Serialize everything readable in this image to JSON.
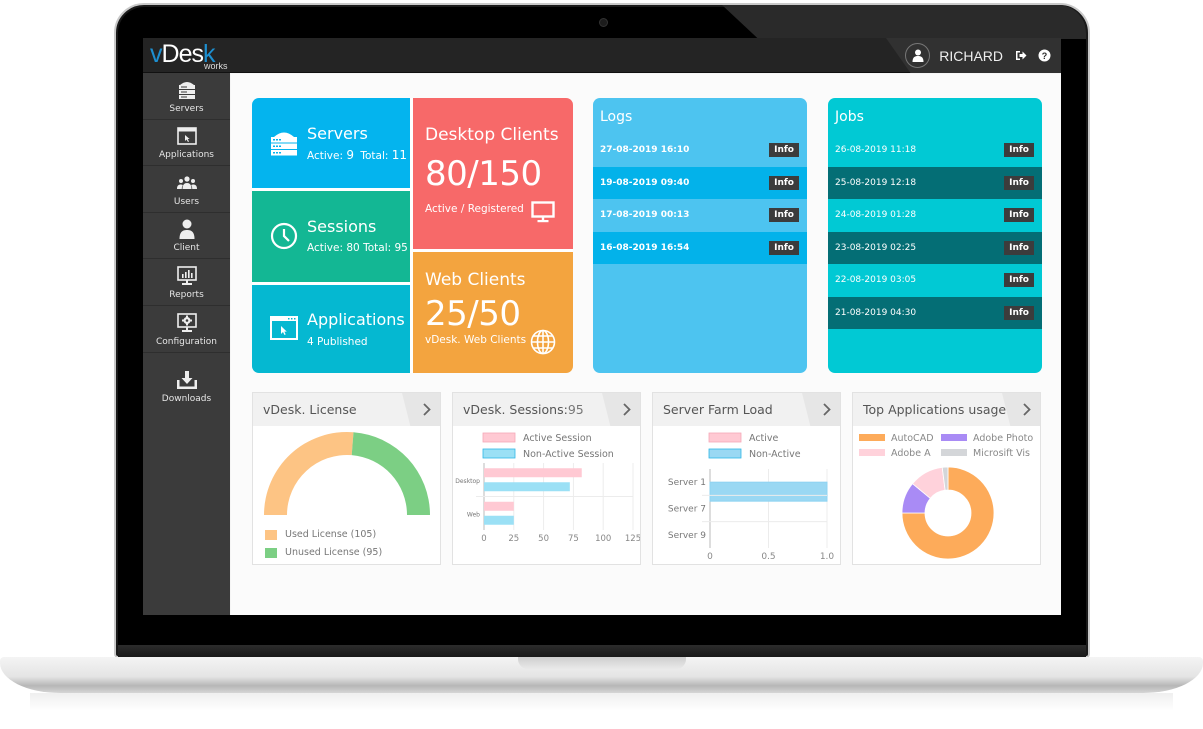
{
  "app": {
    "logo_main": "vDesk",
    "logo_sub": "works"
  },
  "header": {
    "username": "RICHARD",
    "icons": [
      "user-avatar-icon",
      "logout-icon",
      "help-icon"
    ]
  },
  "sidebar": {
    "items": [
      {
        "label": "Servers",
        "icon": "server-icon"
      },
      {
        "label": "Applications",
        "icon": "application-window-icon"
      },
      {
        "label": "Users",
        "icon": "users-group-icon"
      },
      {
        "label": "Client",
        "icon": "client-user-icon"
      },
      {
        "label": "Reports",
        "icon": "reports-monitor-icon"
      },
      {
        "label": "Configuration",
        "icon": "configuration-monitor-icon"
      },
      {
        "label": "Downloads",
        "icon": "download-icon"
      }
    ]
  },
  "tiles": {
    "servers": {
      "title": "Servers",
      "active_label": "Active:",
      "active": "9",
      "total_label": "Total:",
      "total": "11",
      "color": "#04b4ee"
    },
    "sessions": {
      "title": "Sessions",
      "active_label": "Active:",
      "active": "80",
      "total_label": "Total:",
      "total": "95",
      "color": "#13b794"
    },
    "applications": {
      "title": "Applications",
      "subtitle": "4 Published",
      "color": "#05b8d1"
    },
    "desktop_clients": {
      "title": "Desktop Clients",
      "value": "80/150",
      "subtitle": "Active / Registered",
      "color": "#f76969"
    },
    "web_clients": {
      "title": "Web Clients",
      "value": "25/50",
      "subtitle": "vDesk. Web Clients",
      "color": "#f3a43f"
    }
  },
  "logs": {
    "title": "Logs",
    "rows": [
      {
        "time": "27-08-2019 16:10",
        "button": "Info"
      },
      {
        "time": "19-08-2019 09:40",
        "button": "Info"
      },
      {
        "time": "17-08-2019 00:13",
        "button": "Info"
      },
      {
        "time": "16-08-2019 16:54",
        "button": "Info"
      }
    ]
  },
  "jobs": {
    "title": "Jobs",
    "rows": [
      {
        "time": "26-08-2019 11:18",
        "button": "Info"
      },
      {
        "time": "25-08-2019 12:18",
        "button": "Info"
      },
      {
        "time": "24-08-2019 01:28",
        "button": "Info"
      },
      {
        "time": "23-08-2019 02:25",
        "button": "Info"
      },
      {
        "time": "22-08-2019 03:05",
        "button": "Info"
      },
      {
        "time": "21-08-2019 04:30",
        "button": "Info"
      }
    ]
  },
  "cards": {
    "license": {
      "title": "vDesk. License"
    },
    "sessions": {
      "title": "vDesk. Sessions:",
      "count": "95"
    },
    "farm": {
      "title": "Server Farm Load"
    },
    "apps": {
      "title": "Top Applications usage"
    }
  },
  "chart_data": [
    {
      "type": "pie",
      "variant": "semi-donut",
      "title": "vDesk. License",
      "labels": [
        "Used License (105)",
        "Unused License (95)"
      ],
      "values": [
        105,
        95
      ],
      "colors": [
        "#fdc484",
        "#7ccf84"
      ],
      "legend": "bottom-left"
    },
    {
      "type": "bar",
      "orientation": "horizontal",
      "title": "vDesk. Sessions: 95",
      "categories": [
        "Desktop",
        "Web"
      ],
      "series": [
        {
          "name": "Active Session",
          "values": [
            82,
            25
          ],
          "color": "#ffc9d3"
        },
        {
          "name": "Non-Active Session",
          "values": [
            72,
            25
          ],
          "color": "#9be0f5"
        }
      ],
      "xticks": [
        "0",
        "25",
        "50",
        "75",
        "100",
        "125"
      ],
      "xlim": [
        0,
        125
      ],
      "grid": true,
      "legend": "top"
    },
    {
      "type": "bar",
      "orientation": "horizontal",
      "title": "Server Farm Load",
      "categories": [
        "Server 1",
        "Server 7",
        "Server 9"
      ],
      "series": [
        {
          "name": "Active",
          "values": [
            0,
            0,
            0
          ],
          "color": "#ffc9d3"
        },
        {
          "name": "Non-Active",
          "values": [
            1.0,
            0,
            0
          ],
          "color": "#9ad8f3"
        }
      ],
      "xticks": [
        "0",
        "0.5",
        "1.0"
      ],
      "xlim": [
        0,
        1.0
      ],
      "grid": true,
      "legend": "top"
    },
    {
      "type": "pie",
      "variant": "donut",
      "title": "Top Applications usage",
      "labels": [
        "AutoCAD",
        "Adobe Photo",
        "Adobe A",
        "Microsift Vis"
      ],
      "values": [
        75,
        11,
        12,
        2
      ],
      "colors": [
        "#fdab5a",
        "#a98bf5",
        "#ffd2db",
        "#d4d6d9"
      ],
      "legend": "top"
    }
  ]
}
